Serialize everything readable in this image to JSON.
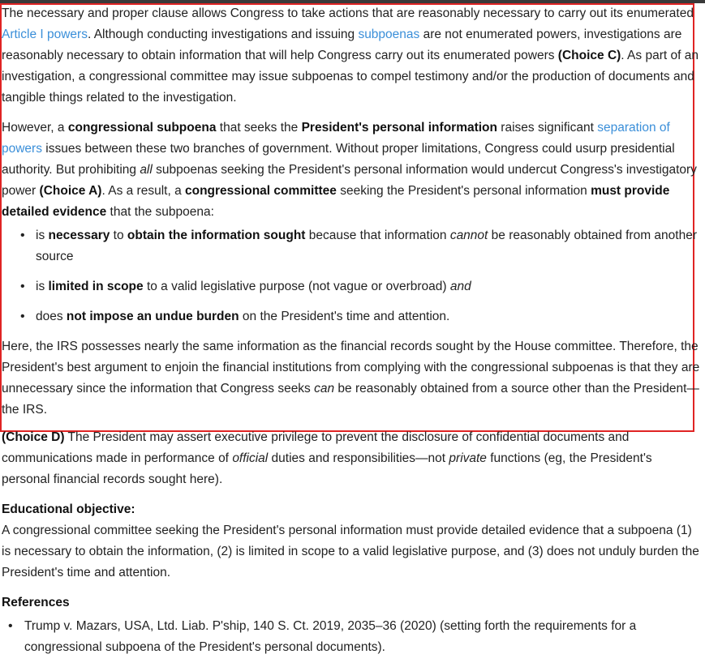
{
  "p1": {
    "t1": "The necessary and proper clause allows Congress to take actions that are reasonably necessary to carry out its enumerated ",
    "link1": "Article I powers",
    "t2": ".  Although conducting investigations and issuing ",
    "link2": "subpoenas",
    "t3": " are not enumerated powers, investigations are reasonably necessary to obtain information that will help Congress carry out its enumerated powers ",
    "b1": "(Choice C)",
    "t4": ".  As part of an investigation, a congressional committee may issue subpoenas to compel testimony and/or the production of documents and tangible things related to the investigation."
  },
  "p2": {
    "t1": "However, a ",
    "b1": "congressional subpoena",
    "t2": " that seeks the ",
    "b2": "President's personal information",
    "t3": " raises significant ",
    "link1": "separation of powers",
    "t4": " issues between these two branches of government.  Without proper limitations, Congress could usurp presidential authority.  But prohibiting ",
    "i1": "all",
    "t5": " subpoenas seeking the President's personal information would undercut Congress's investigatory power ",
    "b3": "(Choice A)",
    "t6": ".  As a result, a ",
    "b4": "congressional committee",
    "t7": " seeking the President's personal information ",
    "b5": "must provide detailed evidence",
    "t8": " that the subpoena:"
  },
  "bullets": [
    {
      "t1": "is ",
      "b1": "necessary",
      "t2": " to ",
      "b2": "obtain the information sought",
      "t3": " because that information ",
      "i1": "cannot",
      "t4": " be reasonably obtained from another source"
    },
    {
      "t1": "is ",
      "b1": "limited in scope",
      "t2": " to a valid legislative purpose (not vague or overbroad) ",
      "i1": "and"
    },
    {
      "t1": "does ",
      "b1": "not impose an undue burden",
      "t2": " on the President's time and attention."
    }
  ],
  "p3": {
    "t1": "Here, the IRS possesses nearly the same information as the financial records sought by the House committee.  Therefore, the President's best argument to enjoin the financial institutions from complying with the congressional subpoenas is that they are unnecessary since the information that Congress seeks ",
    "i1": "can",
    "t2": " be reasonably obtained from a source other than the President—the IRS."
  },
  "p4": {
    "b1": "(Choice D)",
    "t1": "  The President may assert executive privilege to prevent the disclosure of confidential documents and communications made in performance of ",
    "i1": "official",
    "t2": " duties and responsibilities—not ",
    "i2": "private",
    "t3": " functions (eg, the President's personal financial records sought here)."
  },
  "objective": {
    "heading": "Educational objective:",
    "text": "A congressional committee seeking the President's personal information must provide detailed evidence that a subpoena (1) is necessary to obtain the information, (2) is limited in scope to a valid legislative purpose, and (3) does not unduly burden the President's time and attention."
  },
  "references": {
    "heading": "References",
    "items": [
      "Trump v. Mazars, USA, Ltd. Liab. P'ship, 140 S. Ct. 2019, 2035–36 (2020) (setting forth the requirements for a congressional subpoena of the President's personal documents)."
    ]
  }
}
